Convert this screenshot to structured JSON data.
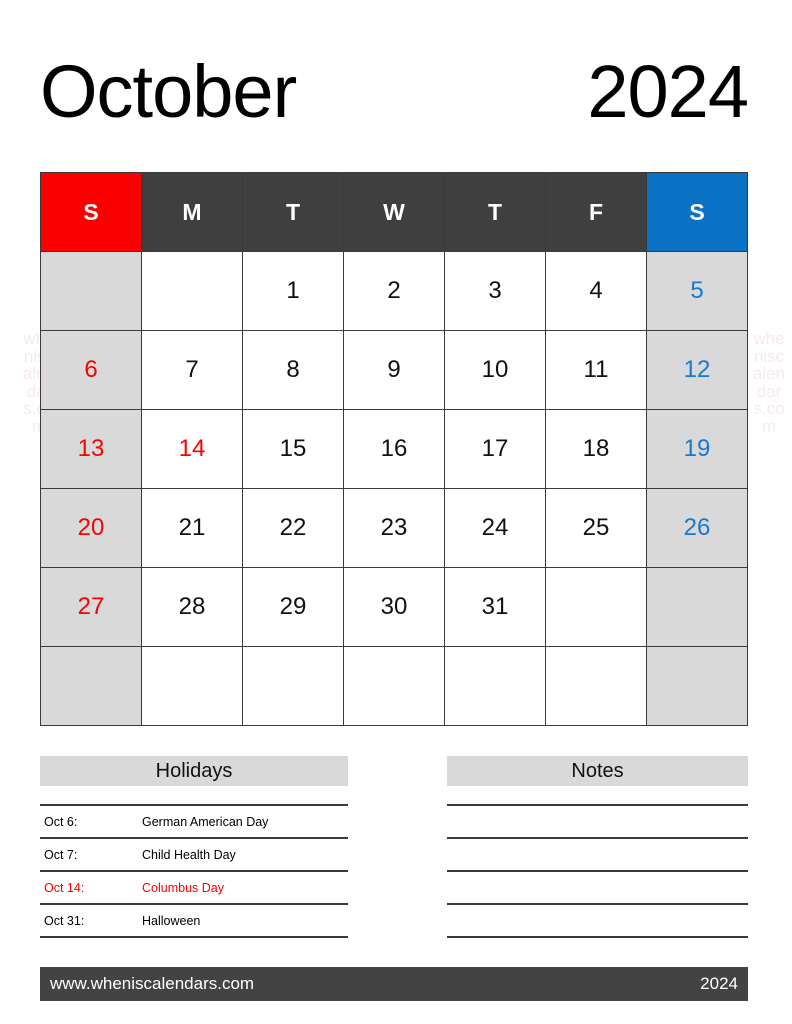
{
  "document": {
    "month": "October",
    "year": "2024"
  },
  "watermark": {
    "text": "wheniscalendars.com"
  },
  "calendar": {
    "weekday_headers": [
      {
        "label": "S",
        "kind": "sunday"
      },
      {
        "label": "M",
        "kind": "weekday"
      },
      {
        "label": "T",
        "kind": "weekday"
      },
      {
        "label": "W",
        "kind": "weekday"
      },
      {
        "label": "T",
        "kind": "weekday"
      },
      {
        "label": "F",
        "kind": "weekday"
      },
      {
        "label": "S",
        "kind": "saturday"
      }
    ],
    "weeks": [
      [
        "",
        "",
        "1",
        "2",
        "3",
        "4",
        "5"
      ],
      [
        "6",
        "7",
        "8",
        "9",
        "10",
        "11",
        "12"
      ],
      [
        "13",
        "14",
        "15",
        "16",
        "17",
        "18",
        "19"
      ],
      [
        "20",
        "21",
        "22",
        "23",
        "24",
        "25",
        "26"
      ],
      [
        "27",
        "28",
        "29",
        "30",
        "31",
        "",
        ""
      ],
      [
        "",
        "",
        "",
        "",
        "",
        "",
        ""
      ]
    ],
    "highlighted_dates": [
      "14"
    ]
  },
  "holidays": {
    "title": "Holidays",
    "items": [
      {
        "date": "Oct 6:",
        "name": "German American Day",
        "highlighted": false
      },
      {
        "date": "Oct 7:",
        "name": "Child Health Day",
        "highlighted": false
      },
      {
        "date": "Oct 14:",
        "name": "Columbus Day",
        "highlighted": true
      },
      {
        "date": "Oct 31:",
        "name": "Halloween",
        "highlighted": false
      }
    ]
  },
  "notes": {
    "title": "Notes",
    "lines": [
      "",
      "",
      "",
      "",
      ""
    ]
  },
  "footer": {
    "website": "www.wheniscalendars.com",
    "year": "2024"
  },
  "colors": {
    "sunday_header": "#fc0000",
    "weekday_header": "#3f3f3f",
    "saturday_header": "#0a72c4",
    "weekend_cell_bg": "#d9d9d9",
    "sunday_text": "#fc0000",
    "saturday_text": "#1779d0",
    "panel_header_bg": "#d9d9d9",
    "footer_bg": "#434343",
    "grid_line": "#3a3a3a"
  }
}
